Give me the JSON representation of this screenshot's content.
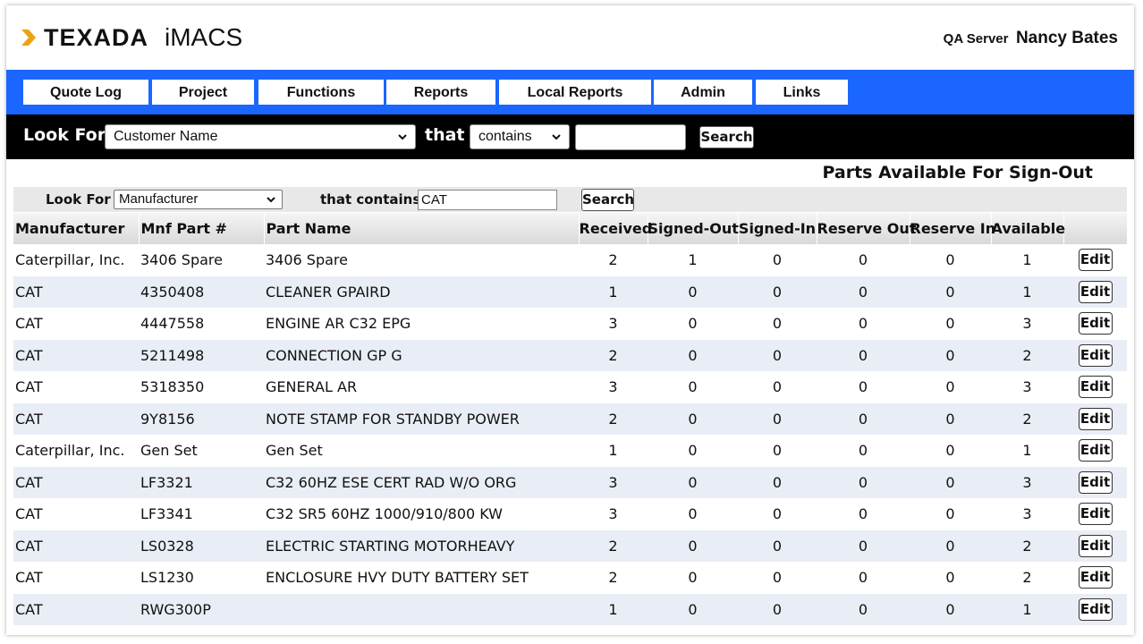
{
  "header": {
    "brand": "TEXADA",
    "app_name": "iMACS",
    "server": "QA Server",
    "user": "Nancy Bates"
  },
  "nav": {
    "items": [
      "Quote Log",
      "Project",
      "Functions",
      "Reports",
      "Local Reports",
      "Admin",
      "Links"
    ]
  },
  "search": {
    "look_for_label": "Look For",
    "field_value": "Customer Name",
    "that_label": "that",
    "operator_value": "contains",
    "query_value": "",
    "button_label": "Search"
  },
  "page": {
    "title": "Parts Available For Sign-Out"
  },
  "filter": {
    "look_for_label": "Look For",
    "field_value": "Manufacturer",
    "that_contains_label": "that contains",
    "query_value": "CAT",
    "button_label": "Search"
  },
  "table": {
    "columns": [
      "Manufacturer",
      "Mnf Part #",
      "Part Name",
      "Received",
      "Signed-Out",
      "Signed-In",
      "Reserve Out",
      "Reserve In",
      "Available"
    ],
    "edit_label": "Edit",
    "rows": [
      {
        "manufacturer": "Caterpillar, Inc.",
        "part_no": "3406 Spare",
        "part_name": "3406 Spare",
        "received": "2",
        "signed_out": "1",
        "signed_in": "0",
        "reserve_out": "0",
        "reserve_in": "0",
        "available": "1"
      },
      {
        "manufacturer": "CAT",
        "part_no": "4350408",
        "part_name": "CLEANER GPAIRD",
        "received": "1",
        "signed_out": "0",
        "signed_in": "0",
        "reserve_out": "0",
        "reserve_in": "0",
        "available": "1"
      },
      {
        "manufacturer": "CAT",
        "part_no": "4447558",
        "part_name": "ENGINE AR C32 EPG",
        "received": "3",
        "signed_out": "0",
        "signed_in": "0",
        "reserve_out": "0",
        "reserve_in": "0",
        "available": "3"
      },
      {
        "manufacturer": "CAT",
        "part_no": "5211498",
        "part_name": "CONNECTION GP G",
        "received": "2",
        "signed_out": "0",
        "signed_in": "0",
        "reserve_out": "0",
        "reserve_in": "0",
        "available": "2"
      },
      {
        "manufacturer": "CAT",
        "part_no": "5318350",
        "part_name": "GENERAL AR",
        "received": "3",
        "signed_out": "0",
        "signed_in": "0",
        "reserve_out": "0",
        "reserve_in": "0",
        "available": "3"
      },
      {
        "manufacturer": "CAT",
        "part_no": "9Y8156",
        "part_name": "NOTE STAMP FOR STANDBY POWER",
        "received": "2",
        "signed_out": "0",
        "signed_in": "0",
        "reserve_out": "0",
        "reserve_in": "0",
        "available": "2"
      },
      {
        "manufacturer": "Caterpillar, Inc.",
        "part_no": "Gen Set",
        "part_name": "Gen Set",
        "received": "1",
        "signed_out": "0",
        "signed_in": "0",
        "reserve_out": "0",
        "reserve_in": "0",
        "available": "1"
      },
      {
        "manufacturer": "CAT",
        "part_no": "LF3321",
        "part_name": "C32 60HZ ESE CERT RAD W/O ORG",
        "received": "3",
        "signed_out": "0",
        "signed_in": "0",
        "reserve_out": "0",
        "reserve_in": "0",
        "available": "3"
      },
      {
        "manufacturer": "CAT",
        "part_no": "LF3341",
        "part_name": "C32 SR5 60HZ 1000/910/800 KW",
        "received": "3",
        "signed_out": "0",
        "signed_in": "0",
        "reserve_out": "0",
        "reserve_in": "0",
        "available": "3"
      },
      {
        "manufacturer": "CAT",
        "part_no": "LS0328",
        "part_name": "ELECTRIC STARTING MOTORHEAVY",
        "received": "2",
        "signed_out": "0",
        "signed_in": "0",
        "reserve_out": "0",
        "reserve_in": "0",
        "available": "2"
      },
      {
        "manufacturer": "CAT",
        "part_no": "LS1230",
        "part_name": "ENCLOSURE HVY DUTY BATTERY SET",
        "received": "2",
        "signed_out": "0",
        "signed_in": "0",
        "reserve_out": "0",
        "reserve_in": "0",
        "available": "2"
      },
      {
        "manufacturer": "CAT",
        "part_no": "RWG300P",
        "part_name": "",
        "received": "1",
        "signed_out": "0",
        "signed_in": "0",
        "reserve_out": "0",
        "reserve_in": "0",
        "available": "1"
      }
    ]
  },
  "colors": {
    "nav_bg": "#1a66ff",
    "search_bg": "#000000",
    "alt_row_bg": "#e9edf5",
    "logo_accent": "#e8a317"
  },
  "icons": [
    "chevron-logo-icon",
    "chevron-down-icon"
  ]
}
